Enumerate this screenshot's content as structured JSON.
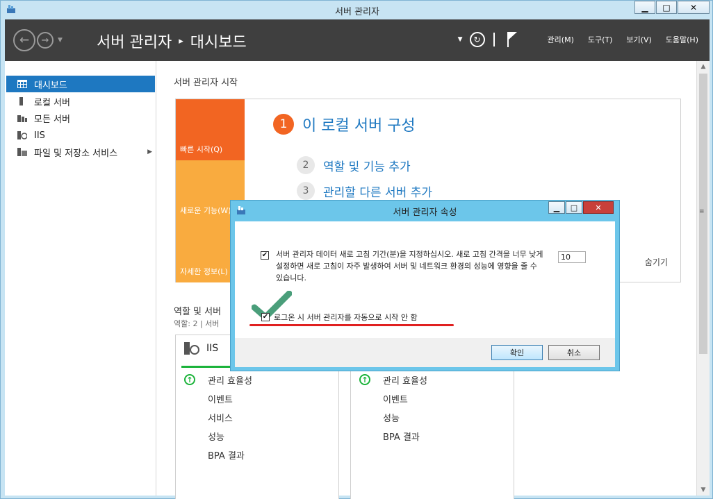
{
  "window": {
    "title": "서버 관리자",
    "controls": [
      "▁",
      "□",
      "✕"
    ]
  },
  "header": {
    "breadcrumb_root": "서버 관리자",
    "breadcrumb_sep": "▸",
    "breadcrumb_current": "대시보드",
    "menu": [
      "관리(M)",
      "도구(T)",
      "보기(V)",
      "도움말(H)"
    ]
  },
  "sidebar": {
    "items": [
      {
        "label": "대시보드",
        "icon": "dashboard-icon",
        "active": true
      },
      {
        "label": "로컬 서버",
        "icon": "server-icon"
      },
      {
        "label": "모든 서버",
        "icon": "servers-icon"
      },
      {
        "label": "IIS",
        "icon": "iis-icon"
      },
      {
        "label": "파일 및 저장소 서비스",
        "icon": "storage-icon",
        "has_arrow": true
      }
    ]
  },
  "main": {
    "section_title": "서버 관리자 시작",
    "tiles": [
      "빠른 시작(Q)",
      "새로운 기능(W)",
      "자세한 정보(L)"
    ],
    "step_main": {
      "num": "1",
      "label": "이 로컬 서버 구성"
    },
    "steps": [
      {
        "num": "2",
        "label": "역할 및 기능 추가"
      },
      {
        "num": "3",
        "label": "관리할 다른 서버 추가"
      }
    ],
    "hide_label": "숨기기",
    "roles_title": "역할 및 서버",
    "roles_sub": "역할: 2  |  서버",
    "cards": [
      {
        "title": "IIS",
        "rows": [
          "관리 효율성",
          "이벤트",
          "서비스",
          "성능",
          "BPA 결과"
        ]
      },
      {
        "title": "",
        "rows": [
          "관리 효율성",
          "이벤트",
          "성능",
          "BPA 결과"
        ]
      }
    ]
  },
  "dialog": {
    "title": "서버 관리자 속성",
    "option1_text": "서버 관리자 데이터 새로 고침 기간(분)을 지정하십시오. 새로 고침 간격을 너무 낮게 설정하면 새로 고침이 자주 발생하여 서버 및 네트워크 환경의 성능에 영향을 줄 수 있습니다.",
    "option1_checked": true,
    "refresh_value": "10",
    "option2_text": "로그온 시 서버 관리자를 자동으로 시작 안 함",
    "option2_checked": true,
    "ok_label": "확인",
    "cancel_label": "취소"
  },
  "colors": {
    "accent": "#1e78c1",
    "orange": "#f26522",
    "light_orange": "#f9ab3f",
    "header_bg": "#3f3f3f",
    "annotation_red": "#e02020",
    "annotation_green": "#4a9e7a"
  }
}
